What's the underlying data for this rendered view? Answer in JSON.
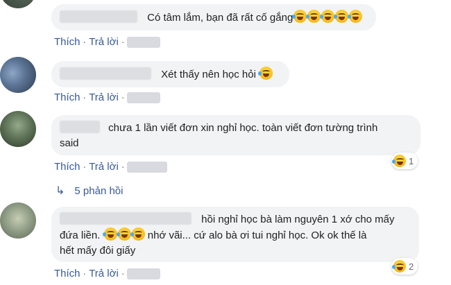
{
  "comments": [
    {
      "text": "Có tâm lắm, bạn đã rất cố gắng",
      "emoji_count": 5,
      "actions": {
        "like": "Thích",
        "reply": "Trả lời"
      }
    },
    {
      "text": "Xét thấy nên học hỏi",
      "emoji_count": 1,
      "actions": {
        "like": "Thích",
        "reply": "Trả lời"
      }
    },
    {
      "text_line1": "chưa 1 lần viết đơn xin nghỉ học. toàn viết đơn tường trình",
      "text_line2": "said",
      "actions": {
        "like": "Thích",
        "reply": "Trả lời"
      },
      "reaction": {
        "icon": "haha-emoji",
        "count": "1"
      },
      "replies": {
        "label": "5 phản hồi"
      }
    },
    {
      "text_line1": "hồi nghỉ học bà làm nguyên 1 xớ cho mấy",
      "text_line2_a": "đứa liền.",
      "text_line2_b": "nhớ vãi... cứ alo bà ơi tui nghỉ học. Ok ok thế là",
      "text_line3": "hết mấy đôi giấy",
      "emoji_count": 3,
      "actions": {
        "like": "Thích",
        "reply": "Trả lời"
      },
      "reaction": {
        "icon": "haha-emoji",
        "count": "2"
      }
    }
  ],
  "colors": {
    "link": "#385898",
    "bubble": "#f2f3f5",
    "meta": "#8d949e",
    "text": "#1c1e21"
  }
}
